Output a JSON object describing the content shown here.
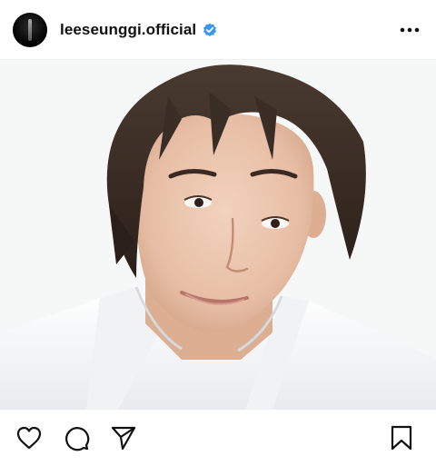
{
  "post": {
    "username": "leeseunggi.official",
    "verified": true,
    "avatar_icon": "profile-avatar",
    "more_icon": "more-horizontal-icon",
    "image_description_icon": "post-photo",
    "colors": {
      "verified_blue": "#3897f0",
      "text": "#111111",
      "icon": "#111111"
    }
  },
  "actions": {
    "like_icon": "heart-icon",
    "comment_icon": "comment-icon",
    "share_icon": "paper-plane-icon",
    "save_icon": "bookmark-icon"
  }
}
